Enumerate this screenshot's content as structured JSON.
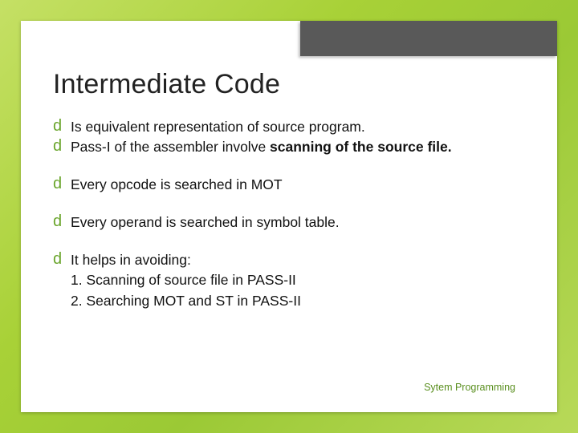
{
  "slide": {
    "title": "Intermediate Code",
    "bullets": {
      "b1_pre": "Is",
      "b1_post": " equivalent representation of source program.",
      "b2_pre": "Pass-I",
      "b2_mid": " of the assembler involve ",
      "b2_bold": "scanning of the source file.",
      "b3_pre": "Every",
      "b3_post": " opcode is searched in MOT",
      "b4_pre": "Every",
      "b4_post": " operand is searched in symbol table.",
      "b5_pre": "It",
      "b5_post": " helps in avoiding:",
      "sub1": "1. Scanning of source file in PASS-II",
      "sub2": "2. Searching MOT and ST in PASS-II"
    },
    "footer": "Sytem Programming"
  },
  "glyph": "d"
}
